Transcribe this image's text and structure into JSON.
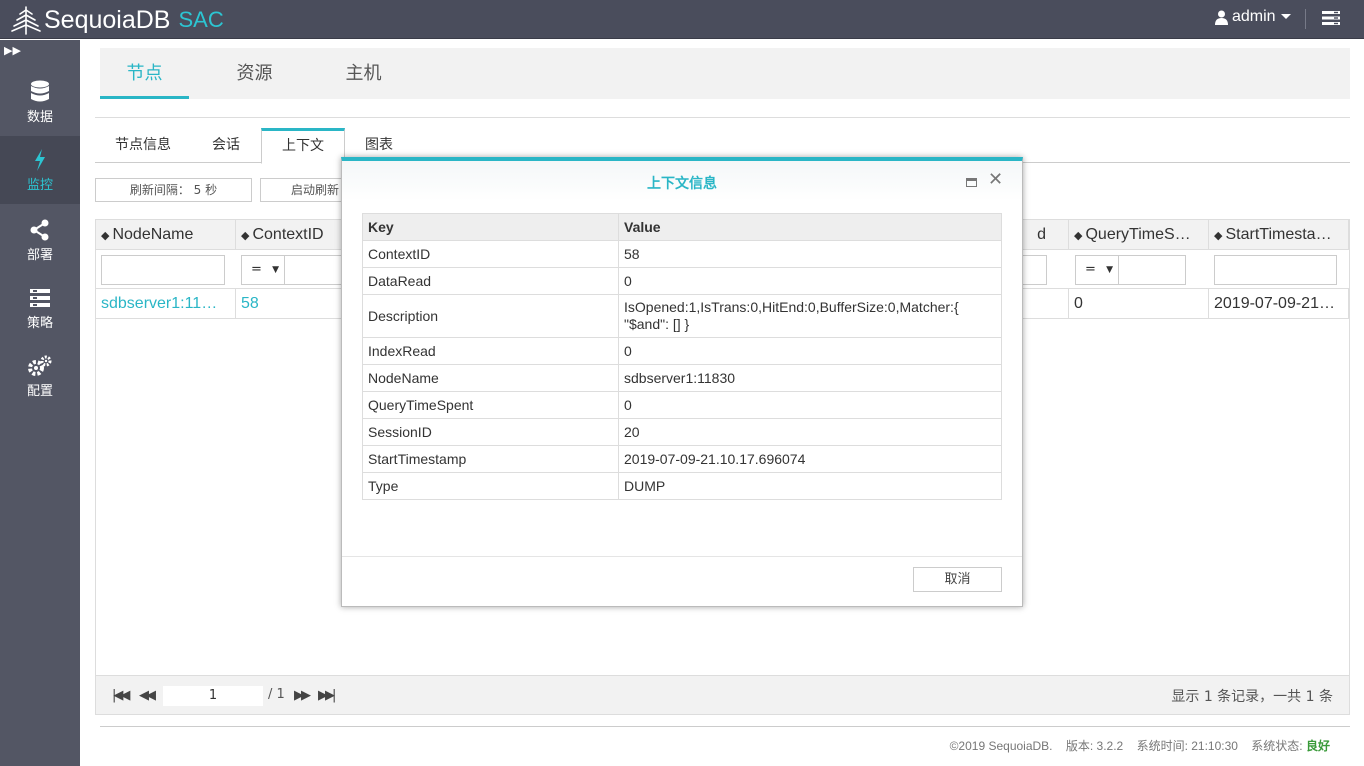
{
  "header": {
    "brand": "SequoiaDB",
    "product": "SAC",
    "user": "admin"
  },
  "sidebar": {
    "items": [
      {
        "label": "数据",
        "icon": "database-icon"
      },
      {
        "label": "监控",
        "icon": "lightning-icon"
      },
      {
        "label": "部署",
        "icon": "share-icon"
      },
      {
        "label": "策略",
        "icon": "strategy-icon"
      },
      {
        "label": "配置",
        "icon": "gears-icon"
      }
    ],
    "active": "监控"
  },
  "main_tabs": [
    "节点",
    "资源",
    "主机"
  ],
  "sub_tabs": [
    "节点信息",
    "会话",
    "上下文",
    "图表"
  ],
  "toolbar": {
    "refresh_interval": "刷新间隔：  5 秒",
    "start_refresh": "启动刷新"
  },
  "table": {
    "columns": [
      "NodeName",
      "ContextID",
      "d",
      "QueryTimeS…",
      "StartTimesta…"
    ],
    "operator": "=",
    "row": {
      "NodeName": "sdbserver1:11…",
      "ContextID": "58",
      "QueryTimeSpent": "0",
      "StartTimestamp": "2019-07-09-21…"
    }
  },
  "pager": {
    "page": "1",
    "total": "/ 1",
    "info": "显示 1 条记录，一共 1 条"
  },
  "footer": {
    "copyright": "©2019 SequoiaDB.",
    "version": "版本: 3.2.2",
    "time": "系统时间: 21:10:30",
    "status_label": "系统状态:",
    "status_value": "良好"
  },
  "modal": {
    "title": "上下文信息",
    "key_header": "Key",
    "value_header": "Value",
    "rows": [
      {
        "k": "ContextID",
        "v": "58"
      },
      {
        "k": "DataRead",
        "v": "0"
      },
      {
        "k": "Description",
        "v": "IsOpened:1,IsTrans:0,HitEnd:0,BufferSize:0,Matcher:{ \"$and\": [] }"
      },
      {
        "k": "IndexRead",
        "v": "0"
      },
      {
        "k": "NodeName",
        "v": "sdbserver1:11830"
      },
      {
        "k": "QueryTimeSpent",
        "v": "0"
      },
      {
        "k": "SessionID",
        "v": "20"
      },
      {
        "k": "StartTimestamp",
        "v": "2019-07-09-21.10.17.696074"
      },
      {
        "k": "Type",
        "v": "DUMP"
      }
    ],
    "cancel": "取消"
  },
  "colors": {
    "accent": "#2ab6c6",
    "topbar": "#4a4d5c",
    "sidebar": "#535664",
    "good": "#3a9a3a"
  }
}
